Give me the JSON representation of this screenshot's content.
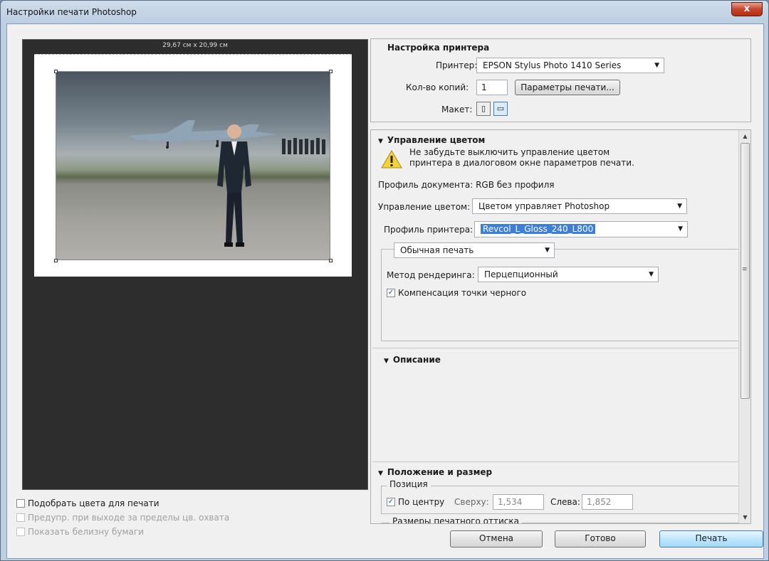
{
  "window": {
    "title": "Настройки печати Photoshop",
    "close_label": "x"
  },
  "preview": {
    "dimensions": "29,67 см x 20,99 см"
  },
  "left_options": [
    {
      "label": "Подобрать цвета для печати",
      "checked": false,
      "enabled": true
    },
    {
      "label": "Предупр. при выходе за пределы цв. охвата",
      "checked": false,
      "enabled": false
    },
    {
      "label": "Показать белизну бумаги",
      "checked": false,
      "enabled": false
    }
  ],
  "printer_setup": {
    "heading": "Настройка принтера",
    "printer_label": "Принтер:",
    "printer_value": "EPSON Stylus Photo 1410 Series",
    "copies_label": "Кол-во копий:",
    "copies_value": "1",
    "print_settings_button": "Параметры печати...",
    "layout_label": "Макет:"
  },
  "color_management": {
    "heading": "Управление цветом",
    "warning_line1": "Не забудьте выключить управление цветом",
    "warning_line2": "принтера в диалоговом окне параметров печати.",
    "doc_profile": "Профиль документа: RGB без профиля",
    "cm_label": "Управление цветом:",
    "cm_value": "Цветом управляет Photoshop",
    "printer_profile_label": "Профиль принтера:",
    "printer_profile_value": "Revcol_L_Gloss_240_L800",
    "print_mode_value": "Обычная печать",
    "rendering_label": "Метод рендеринга:",
    "rendering_value": "Перцепционный",
    "black_point_label": "Компенсация точки черного",
    "black_point_checked": true
  },
  "description": {
    "heading": "Описание"
  },
  "position_size": {
    "heading": "Положение и размер",
    "position_caption": "Позиция",
    "center_label": "По центру",
    "center_checked": true,
    "top_label": "Сверху:",
    "top_value": "1,534",
    "left_label": "Слева:",
    "left_value": "1,852",
    "print_size_caption": "Размеры печатного оттиска"
  },
  "footer": {
    "cancel": "Отмена",
    "done": "Готово",
    "print": "Печать"
  },
  "icons": {
    "triangle": "▼",
    "check": "✓",
    "dropdown": "▼",
    "scroll_up": "▲",
    "scroll_down": "▼",
    "grip": "≡"
  }
}
